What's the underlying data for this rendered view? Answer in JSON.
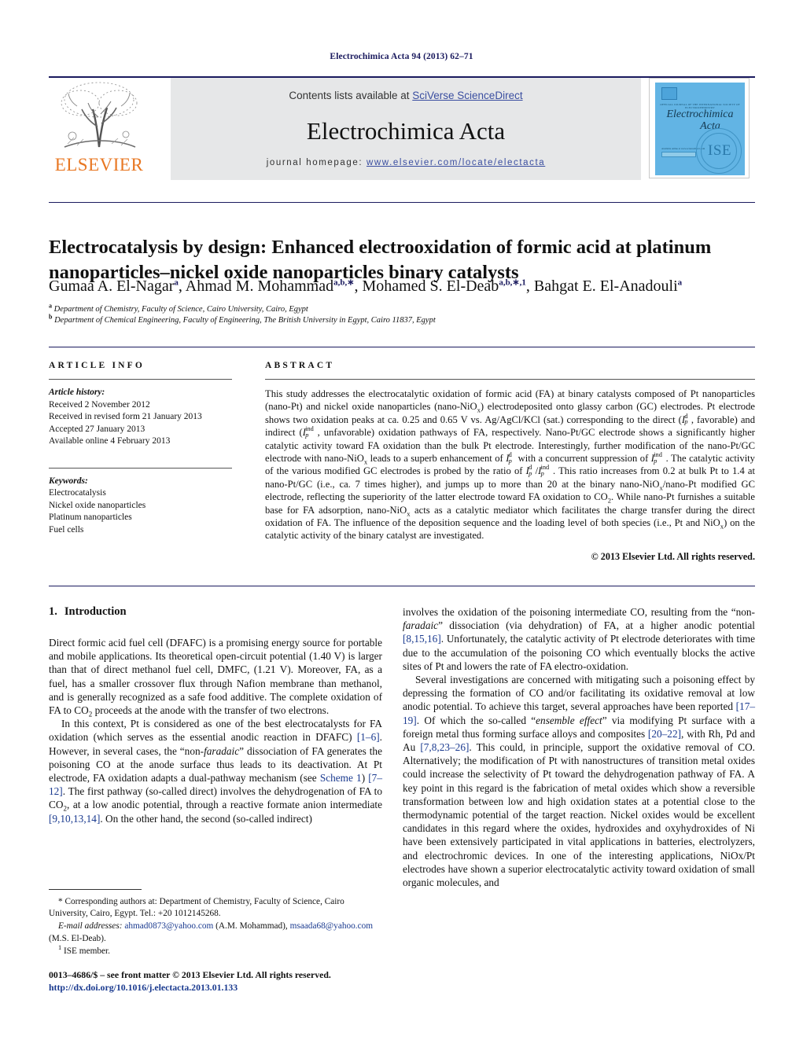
{
  "running_head": "Electrochimica Acta 94 (2013) 62–71",
  "masthead": {
    "contents_prefix": "Contents lists available at ",
    "contents_link": "SciVerse ScienceDirect",
    "journal_title": "Electrochimica Acta",
    "homepage_label": "journal homepage:",
    "homepage_url": "www.elsevier.com/locate/electacta",
    "publisher": "ELSEVIER"
  },
  "cover": {
    "society_line": "OFFICIAL JOURNAL OF THE INTERNATIONAL SOCIETY OF ELECTROCHEMISTRY",
    "title_line1": "Electrochimica",
    "title_line2": "Acta",
    "availability": "Available online at www.sciencedirect.com",
    "seal_text": "ISE"
  },
  "article": {
    "title": "Electrocatalysis by design: Enhanced electrooxidation of formic acid at platinum nanoparticles–nickel oxide nanoparticles binary catalysts",
    "authors": [
      {
        "name": "Gumaa A. El-Nagar",
        "marks": "a"
      },
      {
        "name": "Ahmad M. Mohammad",
        "marks": "a,b,∗"
      },
      {
        "name": "Mohamed S. El-Deab",
        "marks": "a,b,∗,1"
      },
      {
        "name": "Bahgat E. El-Anadouli",
        "marks": "a"
      }
    ],
    "affiliations": [
      {
        "mark": "a",
        "text": "Department of Chemistry, Faculty of Science, Cairo University, Cairo, Egypt"
      },
      {
        "mark": "b",
        "text": "Department of Chemical Engineering, Faculty of Engineering, The British University in Egypt, Cairo 11837, Egypt"
      }
    ]
  },
  "article_info": {
    "heading": "ARTICLE INFO",
    "history_label": "Article history:",
    "history": [
      "Received 2 November 2012",
      "Received in revised form 21 January 2013",
      "Accepted 27 January 2013",
      "Available online 4 February 2013"
    ],
    "keywords_label": "Keywords:",
    "keywords": [
      "Electrocatalysis",
      "Nickel oxide nanoparticles",
      "Platinum nanoparticles",
      "Fuel cells"
    ]
  },
  "abstract": {
    "heading": "ABSTRACT",
    "p1_a": "This study addresses the electrocatalytic oxidation of formic acid (FA) at binary catalysts composed of Pt nanoparticles (nano-Pt) and nickel oxide nanoparticles (nano-NiO",
    "p1_b": ") electrodeposited onto glassy carbon (GC) electrodes. Pt electrode shows two oxidation peaks at ca. 0.25 and 0.65 V vs. Ag/AgCl/KCl (sat.) corresponding to the direct (",
    "p1_c": ", favorable) and indirect (",
    "p1_d": ", unfavorable) oxidation pathways of FA, respectively. Nano-Pt/GC electrode shows a significantly higher catalytic activity toward FA oxidation than the bulk Pt electrode. Interestingly, further modification of the nano-Pt/GC electrode with nano-NiO",
    "p1_e": " leads to a superb enhancement of ",
    "p1_f": " with a concurrent suppression of ",
    "p1_g": ". The catalytic activity of the various modified GC electrodes is probed by the ratio of ",
    "p1_h": ". This ratio increases from 0.2 at bulk Pt to 1.4 at nano-Pt/GC (i.e., ca. 7 times higher), and jumps up to more than 20 at the binary nano-NiO",
    "p1_i": "/nano-Pt modified GC electrode, reflecting the superiority of the latter electrode toward FA oxidation to CO",
    "p1_j": ". While nano-Pt furnishes a suitable base for FA adsorption, nano-NiO",
    "p1_k": " acts as a catalytic mediator which facilitates the charge transfer during the direct oxidation of FA. The influence of the deposition sequence and the loading level of both species (i.e., Pt and NiO",
    "p1_l": ") on the catalytic activity of the binary catalyst are investigated.",
    "copyright": "© 2013 Elsevier Ltd. All rights reserved."
  },
  "body": {
    "section_number": "1.",
    "section_title": "Introduction",
    "left": {
      "p1_a": "Direct formic acid fuel cell (DFAFC) is a promising energy source for portable and mobile applications. Its theoretical open-circuit potential (1.40 V) is larger than that of direct methanol fuel cell, DMFC, (1.21 V). Moreover, FA, as a fuel, has a smaller crossover flux through Nafion membrane than methanol, and is generally recognized as a safe food additive. The complete oxidation of FA to CO",
      "p1_b": " proceeds at the anode with the transfer of two electrons.",
      "p2_a": "In this context, Pt is considered as one of the best electrocatalysts for FA oxidation (which serves as the essential anodic reaction in DFAFC) ",
      "p2_ref1": "[1–6]",
      "p2_b": ". However, in several cases, the “non-",
      "p2_ital1": "faradaic",
      "p2_c": "” dissociation of FA generates the poisoning CO at the anode surface thus leads to its deactivation. At Pt electrode, FA oxidation adapts a dual-pathway mechanism (see ",
      "p2_scheme": "Scheme 1",
      "p2_d": ") ",
      "p2_ref2": "[7–12]",
      "p2_e": ". The first pathway (so-called direct) involves the dehydrogenation of FA to CO",
      "p2_f": ", at a low anodic potential, through a reactive formate anion intermediate ",
      "p2_ref3": "[9,10,13,14]",
      "p2_g": ". On the other hand, the second (so-called indirect)"
    },
    "right": {
      "p1_a": "involves the oxidation of the poisoning intermediate CO, resulting from the “non-",
      "p1_ital": "faradaic",
      "p1_b": "” dissociation (via dehydration) of FA, at a higher anodic potential ",
      "p1_ref": "[8,15,16]",
      "p1_c": ". Unfortunately, the catalytic activity of Pt electrode deteriorates with time due to the accumulation of the poisoning CO which eventually blocks the active sites of Pt and lowers the rate of FA electro-oxidation.",
      "p2_a": "Several investigations are concerned with mitigating such a poisoning effect by depressing the formation of CO and/or facilitating its oxidative removal at low anodic potential. To achieve this target, several approaches have been reported ",
      "p2_ref1": "[17–19]",
      "p2_b": ". Of which the so-called “",
      "p2_ital": "ensemble effect",
      "p2_c": "” via modifying Pt surface with a foreign metal thus forming surface alloys and composites ",
      "p2_ref2": "[20–22]",
      "p2_d": ", with Rh, Pd and Au ",
      "p2_ref3": "[7,8,23–26]",
      "p2_e": ". This could, in principle, support the oxidative removal of CO. Alternatively; the modification of Pt with nanostructures of transition metal oxides could increase the selectivity of Pt toward the dehydrogenation pathway of FA. A key point in this regard is the fabrication of metal oxides which show a reversible transformation between low and high oxidation states at a potential close to the thermodynamic potential of the target reaction. Nickel oxides would be excellent candidates in this regard where the oxides, hydroxides and oxyhydroxides of Ni have been extensively participated in vital applications in batteries, electrolyzers, and electrochromic devices. In one of the interesting applications, NiOx/Pt electrodes have shown a superior electrocatalytic activity toward oxidation of small organic molecules, and"
    }
  },
  "footnotes": {
    "corresponding": "* Corresponding authors at: Department of Chemistry, Faculty of Science, Cairo University, Cairo, Egypt. Tel.: +20 1012145268.",
    "email_label": "E-mail addresses:",
    "email1": "ahmad0873@yahoo.com",
    "email1_owner": "(A.M. Mohammad),",
    "email2": "msaada68@yahoo.com",
    "email2_owner": "(M.S. El-Deab).",
    "ise_mark": "1",
    "ise_note": "ISE member.",
    "imprint": "0013–4686/$ – see front matter © 2013 Elsevier Ltd. All rights reserved.",
    "doi": "http://dx.doi.org/10.1016/j.electacta.2013.01.133"
  }
}
